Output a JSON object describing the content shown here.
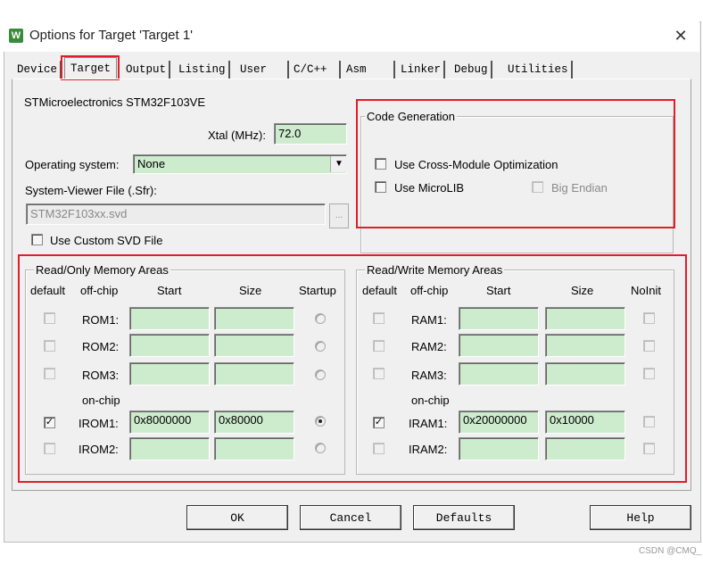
{
  "window": {
    "title": "Options for Target 'Target 1'",
    "app_icon": "keil-uvision-icon",
    "close_glyph": "✕"
  },
  "tabs": [
    {
      "label": "Device",
      "active": false
    },
    {
      "label": "Target",
      "active": true
    },
    {
      "label": "Output",
      "active": false
    },
    {
      "label": "Listing",
      "active": false
    },
    {
      "label": "User",
      "active": false
    },
    {
      "label": "C/C++",
      "active": false
    },
    {
      "label": "Asm",
      "active": false
    },
    {
      "label": "Linker",
      "active": false
    },
    {
      "label": "Debug",
      "active": false
    },
    {
      "label": "Utilities",
      "active": false
    }
  ],
  "target": {
    "device_name": "STMicroelectronics STM32F103VE",
    "xtal_label": "Xtal (MHz):",
    "xtal_value": "72.0",
    "os_label": "Operating system:",
    "os_value": "None",
    "sfr_label": "System-Viewer File (.Sfr):",
    "sfr_value": "STM32F103xx.svd",
    "sfr_browse": "...",
    "custom_svd_label": "Use Custom SVD File",
    "custom_svd_checked": false
  },
  "code_generation": {
    "title": "Code Generation",
    "cross_module_label": "Use Cross-Module Optimization",
    "cross_module_checked": false,
    "microlib_label": "Use MicroLIB",
    "microlib_checked": false,
    "big_endian_label": "Big Endian",
    "big_endian_checked": false,
    "big_endian_enabled": false
  },
  "rom": {
    "title": "Read/Only Memory Areas",
    "headers": {
      "default": "default",
      "offchip": "off-chip",
      "start": "Start",
      "size": "Size",
      "startup": "Startup"
    },
    "onchip_label": "on-chip",
    "rows": [
      {
        "label": "ROM1:",
        "start": "",
        "size": "",
        "default": false,
        "startup": false
      },
      {
        "label": "ROM2:",
        "start": "",
        "size": "",
        "default": false,
        "startup": false
      },
      {
        "label": "ROM3:",
        "start": "",
        "size": "",
        "default": false,
        "startup": false
      },
      {
        "label": "IROM1:",
        "start": "0x8000000",
        "size": "0x80000",
        "default": true,
        "startup": true
      },
      {
        "label": "IROM2:",
        "start": "",
        "size": "",
        "default": false,
        "startup": false
      }
    ]
  },
  "ram": {
    "title": "Read/Write Memory Areas",
    "headers": {
      "default": "default",
      "offchip": "off-chip",
      "start": "Start",
      "size": "Size",
      "noinit": "NoInit"
    },
    "onchip_label": "on-chip",
    "rows": [
      {
        "label": "RAM1:",
        "start": "",
        "size": "",
        "default": false,
        "noinit": false
      },
      {
        "label": "RAM2:",
        "start": "",
        "size": "",
        "default": false,
        "noinit": false
      },
      {
        "label": "RAM3:",
        "start": "",
        "size": "",
        "default": false,
        "noinit": false
      },
      {
        "label": "IRAM1:",
        "start": "0x20000000",
        "size": "0x10000",
        "default": true,
        "noinit": false
      },
      {
        "label": "IRAM2:",
        "start": "",
        "size": "",
        "default": false,
        "noinit": false
      }
    ]
  },
  "buttons": {
    "ok": "OK",
    "cancel": "Cancel",
    "defaults": "Defaults",
    "help": "Help"
  },
  "watermark": "CSDN @CMQ_",
  "colors": {
    "highlight": "#e01e2a",
    "field_bg": "#cdebcd",
    "dialog_bg": "#f0f0f0"
  }
}
